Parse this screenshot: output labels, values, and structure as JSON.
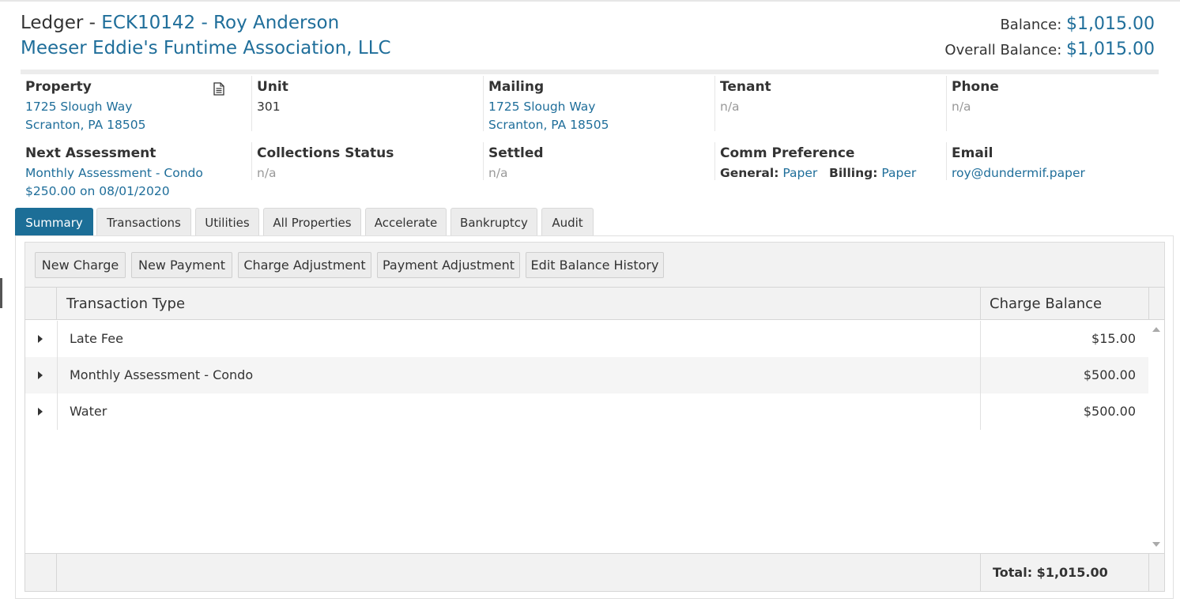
{
  "header": {
    "title_prefix": "Ledger - ",
    "title_link": "ECK10142 - Roy Anderson",
    "association": "Meeser Eddie's Funtime Association, LLC",
    "balance_label": "Balance: ",
    "balance_value": "$1,015.00",
    "overall_balance_label": "Overall Balance: ",
    "overall_balance_value": "$1,015.00"
  },
  "info": {
    "property": {
      "label": "Property",
      "line1": "1725 Slough Way",
      "line2": "Scranton, PA 18505",
      "icon": "document-icon"
    },
    "unit": {
      "label": "Unit",
      "value": "301"
    },
    "mailing": {
      "label": "Mailing",
      "line1": "1725 Slough Way",
      "line2": "Scranton, PA 18505"
    },
    "tenant": {
      "label": "Tenant",
      "value": "n/a"
    },
    "phone": {
      "label": "Phone",
      "value": "n/a"
    },
    "next_assessment": {
      "label": "Next Assessment",
      "line1": "Monthly Assessment - Condo",
      "line2": "$250.00 on 08/01/2020"
    },
    "collections_status": {
      "label": "Collections Status",
      "value": "n/a"
    },
    "settled": {
      "label": "Settled",
      "value": "n/a"
    },
    "comm_preference": {
      "label": "Comm Preference",
      "general_label": "General:",
      "general_value": "Paper",
      "billing_label": "Billing:",
      "billing_value": "Paper"
    },
    "email": {
      "label": "Email",
      "value": "roy@dundermif.paper"
    }
  },
  "tabs": [
    {
      "label": "Summary",
      "active": true
    },
    {
      "label": "Transactions"
    },
    {
      "label": "Utilities"
    },
    {
      "label": "All Properties"
    },
    {
      "label": "Accelerate"
    },
    {
      "label": "Bankruptcy"
    },
    {
      "label": "Audit"
    }
  ],
  "toolbar": {
    "new_charge": "New Charge",
    "new_payment": "New Payment",
    "charge_adjustment": "Charge Adjustment",
    "payment_adjustment": "Payment Adjustment",
    "edit_balance_history": "Edit Balance History"
  },
  "grid": {
    "columns": [
      "Transaction Type",
      "Charge Balance"
    ],
    "rows": [
      {
        "type": "Late Fee",
        "amount": "$15.00"
      },
      {
        "type": "Monthly Assessment - Condo",
        "amount": "$500.00"
      },
      {
        "type": "Water",
        "amount": "$500.00"
      }
    ],
    "total": "Total: $1,015.00"
  },
  "colors": {
    "accent": "#1c6e97",
    "link": "#1f6e9a",
    "muted": "#999999"
  }
}
